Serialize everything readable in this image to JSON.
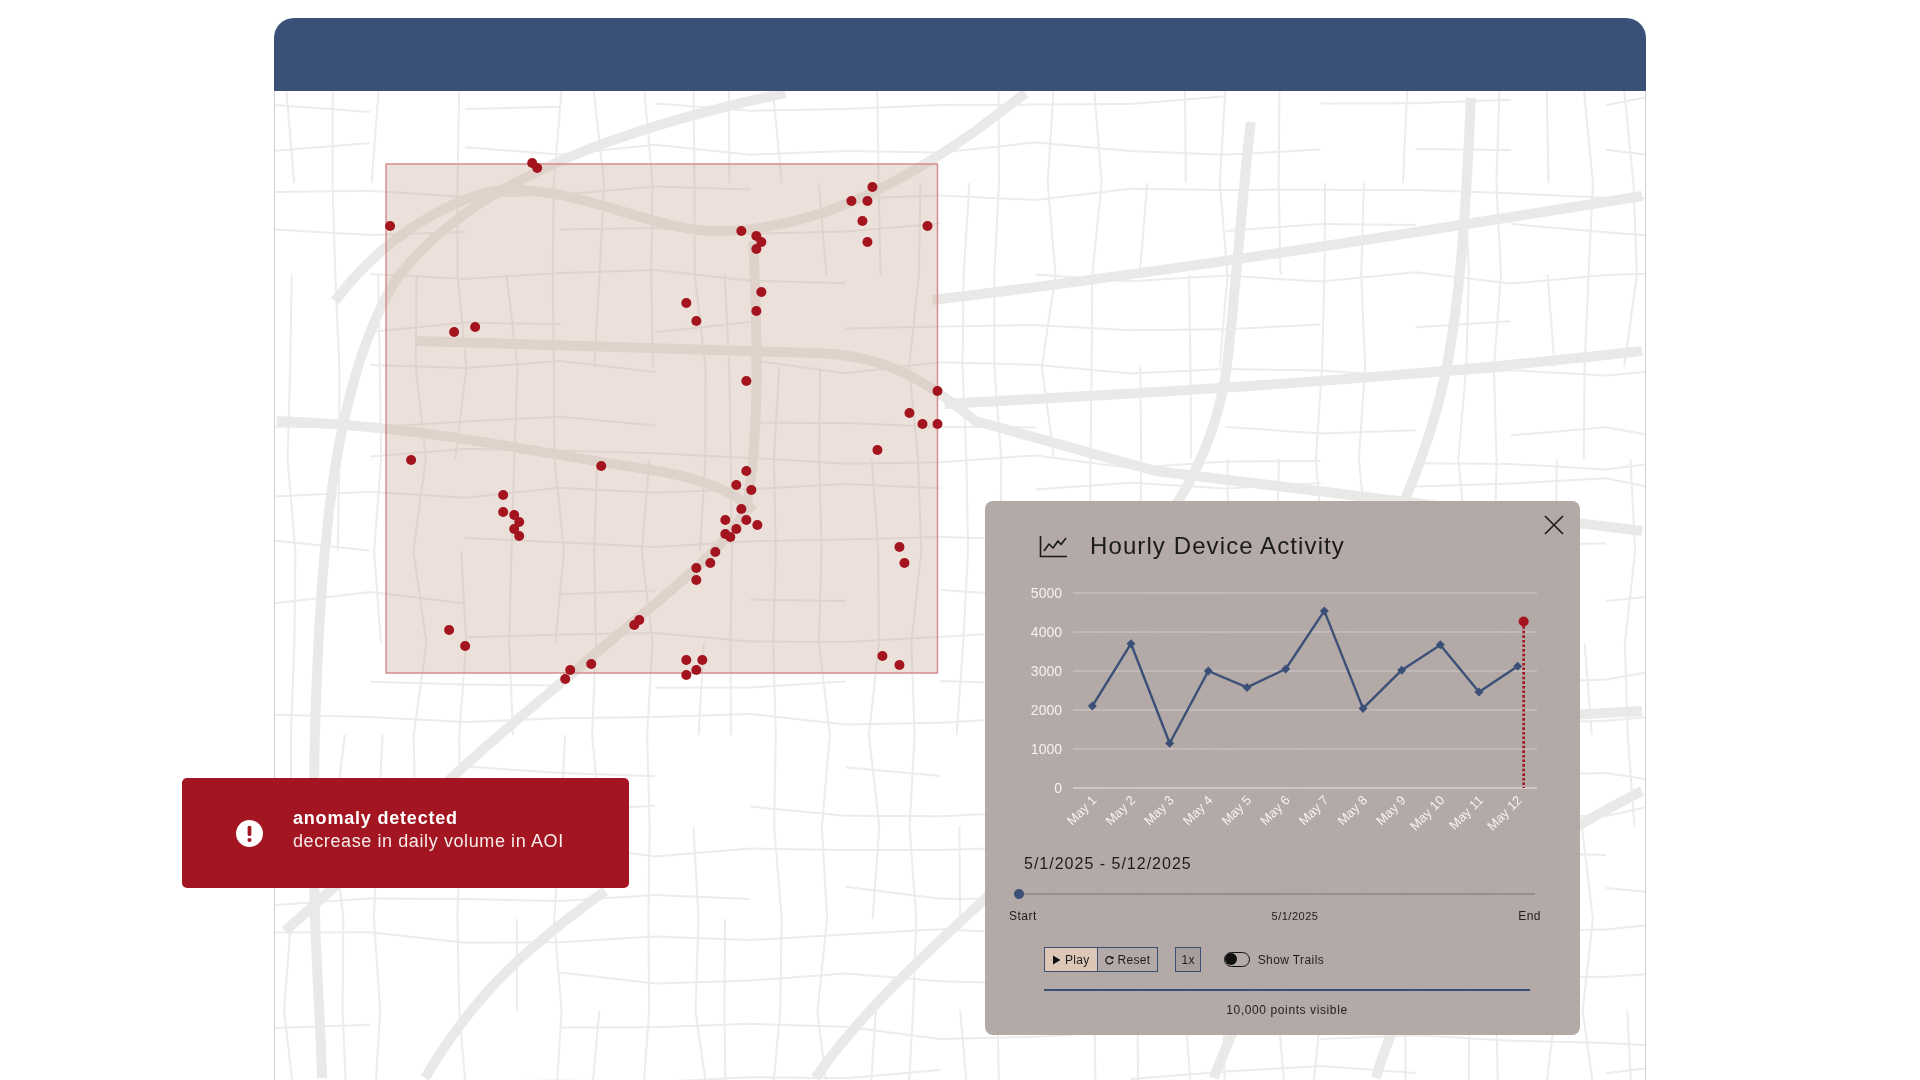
{
  "alert": {
    "kind": "error",
    "title": "anomaly detected",
    "message": "decrease in daily volume in AOI"
  },
  "chart_panel": {
    "title": "Hourly Device Activity",
    "chart_data": {
      "type": "line",
      "categories": [
        "May 1",
        "May 2",
        "May 3",
        "May 4",
        "May 5",
        "May 6",
        "May 7",
        "May 8",
        "May 9",
        "May 10",
        "May 11",
        "May 12"
      ],
      "values": [
        2100,
        3700,
        1150,
        3000,
        2580,
        3050,
        4540,
        2040,
        3020,
        3670,
        2460,
        3120
      ],
      "ylim": [
        0,
        5000
      ],
      "yticks": [
        0,
        1000,
        2000,
        3000,
        4000,
        5000
      ],
      "grid": true,
      "marker": "diamond",
      "ref_lines": [
        {
          "axis": "x",
          "value": "May 12"
        }
      ]
    },
    "date_range": "5/1/2025 - 5/12/2025",
    "timeline": {
      "level": 0,
      "start_label": "Start",
      "current_label": "5/1/2025",
      "end_label": "End"
    },
    "buttons": [
      {
        "kind": "play",
        "label": "Play"
      },
      {
        "kind": "reset",
        "label": "Reset"
      },
      {
        "kind": "speed",
        "label": "1x"
      }
    ],
    "toggle": {
      "label": "Show Trails",
      "on": false
    },
    "status": "10,000 points visible"
  }
}
